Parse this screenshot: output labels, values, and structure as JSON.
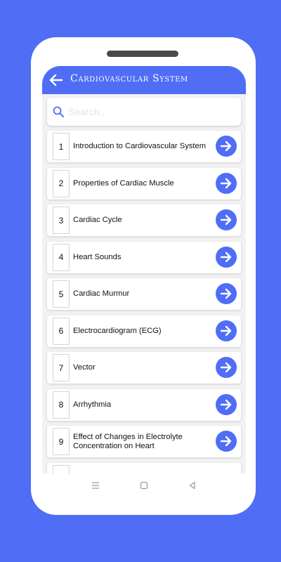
{
  "appbar": {
    "title": "Cardiovascular System",
    "back_icon": "arrow-left-icon"
  },
  "search": {
    "placeholder": "Search..",
    "icon": "search-icon",
    "value": ""
  },
  "colors": {
    "accent": "#4f6df5",
    "background": "#f2f2f2"
  },
  "chapters": [
    {
      "number": "1",
      "label": "Introduction to Cardiovascular System"
    },
    {
      "number": "2",
      "label": "Properties of Cardiac Muscle"
    },
    {
      "number": "3",
      "label": "Cardiac Cycle"
    },
    {
      "number": "4",
      "label": "Heart Sounds"
    },
    {
      "number": "5",
      "label": "Cardiac Murmur"
    },
    {
      "number": "6",
      "label": "Electrocardiogram (ECG)"
    },
    {
      "number": "7",
      "label": "Vector"
    },
    {
      "number": "8",
      "label": "Arrhythmia"
    },
    {
      "number": "9",
      "label": "Effect of Changes in Electrolyte Concentration on Heart"
    }
  ],
  "navbar": {
    "icons": [
      "menu-icon",
      "home-square-icon",
      "back-triangle-icon"
    ]
  }
}
